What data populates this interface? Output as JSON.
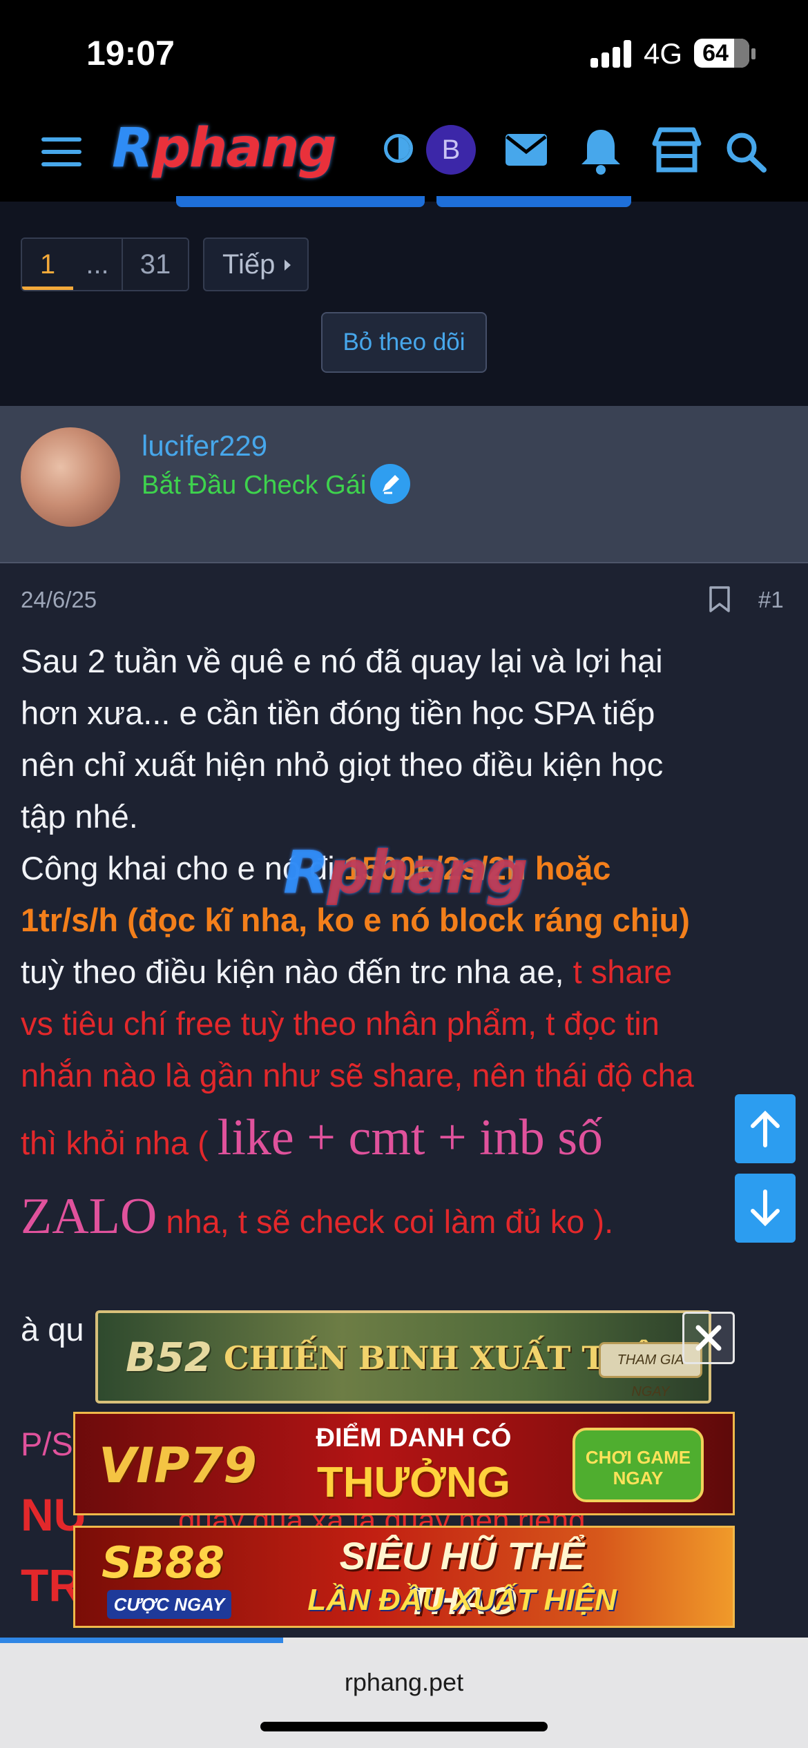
{
  "status_bar": {
    "time": "19:07",
    "network": "4G",
    "battery": "64"
  },
  "header": {
    "logo": "Rphang",
    "avatar_letter": "B",
    "icons": [
      "menu-icon",
      "contrast-icon",
      "mail-icon",
      "bell-icon",
      "store-icon",
      "search-icon"
    ]
  },
  "pagination": {
    "pages": [
      "1",
      "...",
      "31"
    ],
    "current": "1",
    "next_label": "Tiếp"
  },
  "unfollow_button": "Bỏ theo dõi",
  "user": {
    "username": "lucifer229",
    "title": "Bắt Đầu Check Gái"
  },
  "post": {
    "date": "24/6/25",
    "number": "#1",
    "line1": "Sau 2 tuần về quê e nó đã quay lại và lợi hại",
    "line2": "hơn xưa... e cần tiền đóng tiền học SPA tiếp",
    "line3": "nên chỉ xuất hiện nhỏ giọt theo điều kiện học",
    "line4": "tập nhé.",
    "line5_prefix": "Công khai cho e nó đi ",
    "line5_orange": "1500k/2s/2h hoặc",
    "line6_orange": "1tr/s/h (đọc kĩ nha, ko e nó block ráng chịu)",
    "line7_white": "tuỳ theo điều kiện nào đến trc nha ae, ",
    "line7_red": "t share",
    "line8_red": "vs tiêu chí free tuỳ theo nhân phẩm, t đọc tin",
    "line9_red": "nhắn nào là gần như sẽ share, nên thái độ cha",
    "line10_red": "thì khỏi nha ( ",
    "line10_pink": "like + cmt + inb số",
    "line11_pink": "ZALO",
    "line11_red": " nha, t sẽ check coi làm đủ ko ).",
    "watermark": "Rphang",
    "partial_1": "à qu",
    "partial_2": "P/S",
    "partial_3a": "NU",
    "partial_3b": "quay quá xá là quay nên riêng",
    "partial_4": "TR"
  },
  "ads": {
    "b52": {
      "logo": "B52",
      "text": "CHIẾN BINH XUẤT TRẬN",
      "cta": "THAM GIA NGAY"
    },
    "vip79": {
      "logo": "VIP79",
      "top": "ĐIỂM DANH CÓ",
      "main": "THƯỞNG",
      "cta": "CHƠI GAME NGAY"
    },
    "sb88": {
      "logo": "SB88",
      "cta": "CƯỢC NGAY",
      "main": "SIÊU HŨ THỂ THAO",
      "sub": "LẦN ĐẦU XUẤT HIỆN"
    }
  },
  "browser": {
    "url": "rphang.pet",
    "load_progress": 0.35
  },
  "colors": {
    "accent": "#47a7eb",
    "orange": "#f37f1b",
    "red": "#e3282b",
    "pink": "#e0529c",
    "green": "#3ed34d"
  }
}
